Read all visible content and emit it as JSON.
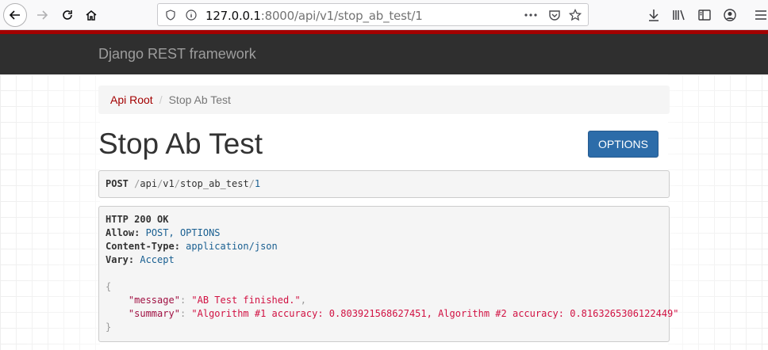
{
  "browser": {
    "url_host": "127.0.0.1",
    "url_rest": ":8000/api/v1/stop_ab_test/1"
  },
  "navbar": {
    "brand": "Django REST framework"
  },
  "breadcrumb": {
    "root": "Api Root",
    "separator": "/",
    "current": "Stop Ab Test"
  },
  "page": {
    "title": "Stop Ab Test",
    "options_label": "OPTIONS"
  },
  "request": {
    "method": "POST",
    "path_parts": [
      "/",
      "api",
      "/",
      "v1",
      "/",
      "stop_ab_test",
      "/",
      "1"
    ]
  },
  "response": {
    "status": "HTTP 200 OK",
    "headers": [
      {
        "name": "Allow:",
        "value": "POST, OPTIONS"
      },
      {
        "name": "Content-Type:",
        "value": "application/json"
      },
      {
        "name": "Vary:",
        "value": "Accept"
      }
    ],
    "open_brace": "{",
    "close_brace": "}",
    "body": [
      {
        "key": "\"message\"",
        "colon": ":",
        "value": "\"AB Test finished.\"",
        "comma": ","
      },
      {
        "key": "\"summary\"",
        "colon": ":",
        "value": "\"Algorithm #1 accuracy: 0.803921568627451, Algorithm #2 accuracy: 0.8163265306122449\"",
        "comma": ""
      }
    ]
  },
  "colors": {
    "accent": "#a30000",
    "navbar": "#2f2f2f",
    "button": "#2c6ca9"
  }
}
